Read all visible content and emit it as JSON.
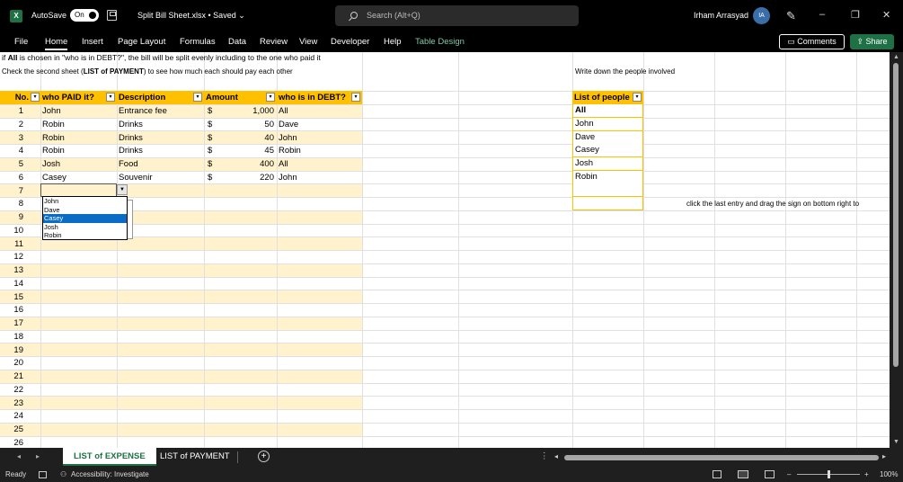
{
  "titlebar": {
    "app_icon": "X",
    "autosave_label": "AutoSave",
    "autosave_state": "On",
    "file_title": "Split Bill Sheet.xlsx • Saved",
    "title_chevron": "⌄",
    "search_placeholder": "Search (Alt+Q)",
    "user_name": "Irham Arrasyad",
    "user_initials": "IA",
    "minimize": "–",
    "restore": "❐",
    "close": "✕"
  },
  "ribbon": {
    "tabs": [
      "File",
      "Home",
      "Insert",
      "Page Layout",
      "Formulas",
      "Data",
      "Review",
      "View",
      "Developer",
      "Help",
      "Table Design"
    ],
    "active_tab": "Home",
    "comments_label": "Comments",
    "share_label": "Share"
  },
  "notes": {
    "line1_prefix": "if ",
    "line1_bold": "All",
    "line1_rest": " is chosen in \"who is in DEBT?\", the bill will be split evenly including to the one who paid it",
    "line2_prefix": "Check the second sheet (",
    "line2_bold": "LIST of PAYMENT",
    "line2_rest": ") to see how much each should pay each other",
    "people_note": "Write down the people involved",
    "drag_note": "click the last entry and drag the sign on bottom right to"
  },
  "expense_table": {
    "headers": [
      "No.",
      "who PAID it?",
      "Description",
      "Amount",
      "who is in DEBT?"
    ],
    "currency": "$",
    "rows": [
      {
        "no": "1",
        "paid": "John",
        "desc": "Entrance fee",
        "amount": "1,000",
        "debt": "All"
      },
      {
        "no": "2",
        "paid": "Robin",
        "desc": "Drinks",
        "amount": "50",
        "debt": "Dave"
      },
      {
        "no": "3",
        "paid": "Robin",
        "desc": "Drinks",
        "amount": "40",
        "debt": "John"
      },
      {
        "no": "4",
        "paid": "Robin",
        "desc": "Drinks",
        "amount": "45",
        "debt": "Robin"
      },
      {
        "no": "5",
        "paid": "Josh",
        "desc": "Food",
        "amount": "400",
        "debt": "All"
      },
      {
        "no": "6",
        "paid": "Casey",
        "desc": "Souvenir",
        "amount": "220",
        "debt": "John"
      }
    ],
    "blank_row_numbers": [
      "7",
      "8",
      "9",
      "10",
      "11",
      "12",
      "13",
      "14",
      "15",
      "16",
      "17",
      "18",
      "19",
      "20",
      "21",
      "22",
      "23",
      "24",
      "25",
      "26"
    ]
  },
  "dropdown": {
    "options": [
      "John",
      "Dave",
      "Casey",
      "Josh",
      "Robin"
    ],
    "selected": "Casey"
  },
  "people": {
    "header": "List of people",
    "items": [
      "All",
      "John",
      "Dave",
      "Casey",
      "Josh",
      "Robin",
      "",
      ""
    ]
  },
  "sheet_tabs": {
    "tabs": [
      "LIST of EXPENSE",
      "LIST of PAYMENT"
    ],
    "active": "LIST of EXPENSE",
    "add_label": "+"
  },
  "status": {
    "ready": "Ready",
    "accessibility": "Accessibility: Investigate",
    "zoom": "100%"
  },
  "colors": {
    "header_fill": "#ffc000",
    "band_fill": "#fff2cc",
    "excel_green": "#1e7145",
    "selection_blue": "#0a6cc4"
  }
}
